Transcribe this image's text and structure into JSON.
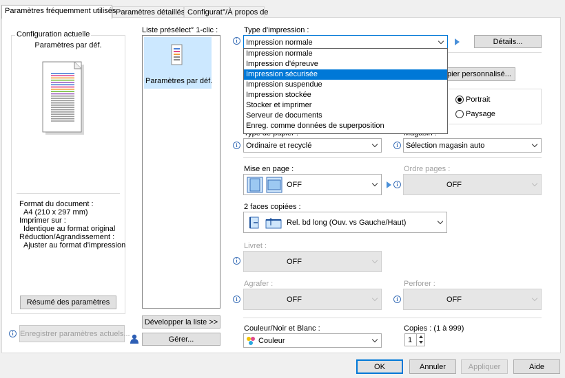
{
  "tabs": [
    {
      "label": "Paramètres fréquemment utilisés"
    },
    {
      "label": "Paramètres détaillés"
    },
    {
      "label": "Configurat°/À propos de"
    }
  ],
  "current_config": {
    "title": "Configuration actuelle",
    "subtitle": "Paramètres par déf.",
    "doc_format_label": "Format du document :",
    "doc_format_value": "A4 (210 x 297 mm)",
    "print_on_label": "Imprimer sur :",
    "print_on_value": "Identique au format original",
    "reduction_label": "Réduction/Agrandissement :",
    "reduction_value": "Ajuster au format d'impression",
    "summary_button": "Résumé des paramètres"
  },
  "save_settings_button": "Enregistrer paramètres actuels...",
  "preset": {
    "label": "Liste présélect° 1-clic :",
    "item_label": "Paramètres par déf.",
    "expand_button": "Développer la liste >>",
    "manage_button": "Gérer..."
  },
  "print_type": {
    "label": "Type d'impression :",
    "value": "Impression normale",
    "details_button": "Détails...",
    "options": [
      "Impression normale",
      "Impression d'épreuve",
      "Impression sécurisée",
      "Impression suspendue",
      "Impression stockée",
      "Stocker et imprimer",
      "Serveur de documents",
      "Enreg. comme données de superposition"
    ],
    "highlighted_index": 2
  },
  "custom_paper_button": "pier personnalisé...",
  "orientation": {
    "portrait": "Portrait",
    "landscape": "Paysage",
    "selected": "Portrait"
  },
  "paper_type": {
    "label": "Type de papier :",
    "value": "Ordinaire et recyclé"
  },
  "tray": {
    "label": "Magasin :",
    "value": "Sélection magasin auto"
  },
  "layout": {
    "label": "Mise en page :",
    "value": "OFF"
  },
  "page_order": {
    "label": "Ordre pages :",
    "value": "OFF"
  },
  "duplex": {
    "label": "2 faces copiées :",
    "value": "Rel. bd long (Ouv. vs Gauche/Haut)"
  },
  "booklet": {
    "label": "Livret :",
    "value": "OFF"
  },
  "staple": {
    "label": "Agrafer :",
    "value": "OFF"
  },
  "punch": {
    "label": "Perforer :",
    "value": "OFF"
  },
  "color": {
    "label": "Couleur/Noir et Blanc :",
    "value": "Couleur"
  },
  "copies": {
    "label": "Copies : (1 à 999)",
    "value": "1"
  },
  "footer": {
    "ok": "OK",
    "cancel": "Annuler",
    "apply": "Appliquer",
    "help": "Aide"
  },
  "colors": {
    "accent": "#0078d7",
    "highlight": "#cce8ff",
    "info_icon": "#3a6fb7"
  }
}
